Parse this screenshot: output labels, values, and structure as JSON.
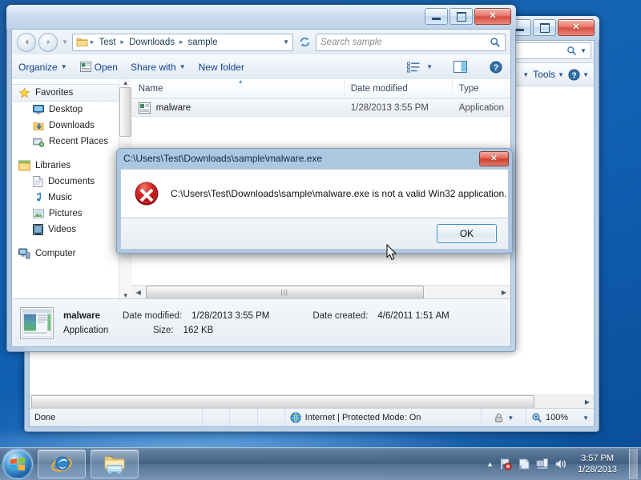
{
  "desktop": {
    "background_color": "#1464b4"
  },
  "ie_window": {
    "title": "",
    "caption_buttons": {
      "minimize": "minimize-button",
      "maximize": "maximize-button",
      "close": "close-button",
      "close_glyph": "✕"
    },
    "command_bar": {
      "tools_label": "Tools",
      "help_label": "?"
    },
    "status_bar": {
      "status_text": "Done",
      "zone_text": "Internet | Protected Mode: On",
      "zoom_level": "100%"
    }
  },
  "explorer": {
    "caption_buttons": {
      "minimize": "minimize-button",
      "maximize": "maximize-button",
      "close": "close-button",
      "close_glyph": "✕"
    },
    "address_bar": {
      "crumbs": [
        "Test",
        "Downloads",
        "sample"
      ],
      "separator": "▸"
    },
    "search": {
      "placeholder": "Search sample"
    },
    "toolbar": {
      "organize": "Organize",
      "open": "Open",
      "share_with": "Share with",
      "new_folder": "New folder"
    },
    "nav_pane": {
      "groups": [
        {
          "label": "Favorites",
          "icon": "star-icon",
          "selected": true,
          "children": [
            {
              "label": "Desktop",
              "icon": "desktop-icon"
            },
            {
              "label": "Downloads",
              "icon": "downloads-icon"
            },
            {
              "label": "Recent Places",
              "icon": "recent-places-icon"
            }
          ]
        },
        {
          "label": "Libraries",
          "icon": "libraries-icon",
          "selected": false,
          "children": [
            {
              "label": "Documents",
              "icon": "documents-icon"
            },
            {
              "label": "Music",
              "icon": "music-icon"
            },
            {
              "label": "Pictures",
              "icon": "pictures-icon"
            },
            {
              "label": "Videos",
              "icon": "videos-icon"
            }
          ]
        },
        {
          "label": "Computer",
          "icon": "computer-icon",
          "selected": false,
          "children": []
        }
      ]
    },
    "file_list": {
      "columns": [
        "Name",
        "Date modified",
        "Type"
      ],
      "rows": [
        {
          "name": "malware",
          "date_modified": "1/28/2013 3:55 PM",
          "type": "Application",
          "icon": "application-icon"
        }
      ]
    },
    "details_pane": {
      "file_name": "malware",
      "file_type": "Application",
      "date_modified_label": "Date modified:",
      "date_modified_value": "1/28/2013 3:55 PM",
      "size_label": "Size:",
      "size_value": "162 KB",
      "date_created_label": "Date created:",
      "date_created_value": "4/6/2011 1:51 AM"
    }
  },
  "error_dialog": {
    "title": "C:\\Users\\Test\\Downloads\\sample\\malware.exe",
    "message": "C:\\Users\\Test\\Downloads\\sample\\malware.exe is not a valid Win32 application.",
    "ok_label": "OK",
    "close_glyph": "✕",
    "icon": "error-icon",
    "icon_color": "#c9202a"
  },
  "taskbar": {
    "start_button": "start-orb",
    "buttons": [
      {
        "name": "internet-explorer",
        "icon": "internet-explorer-icon"
      },
      {
        "name": "windows-explorer",
        "icon": "folder-icon"
      }
    ],
    "tray": {
      "show_hidden": "▲",
      "icons": [
        "network-flag-icon",
        "action-center-icon",
        "network-icon",
        "volume-icon"
      ],
      "time": "3:57 PM",
      "date": "1/28/2013"
    }
  }
}
